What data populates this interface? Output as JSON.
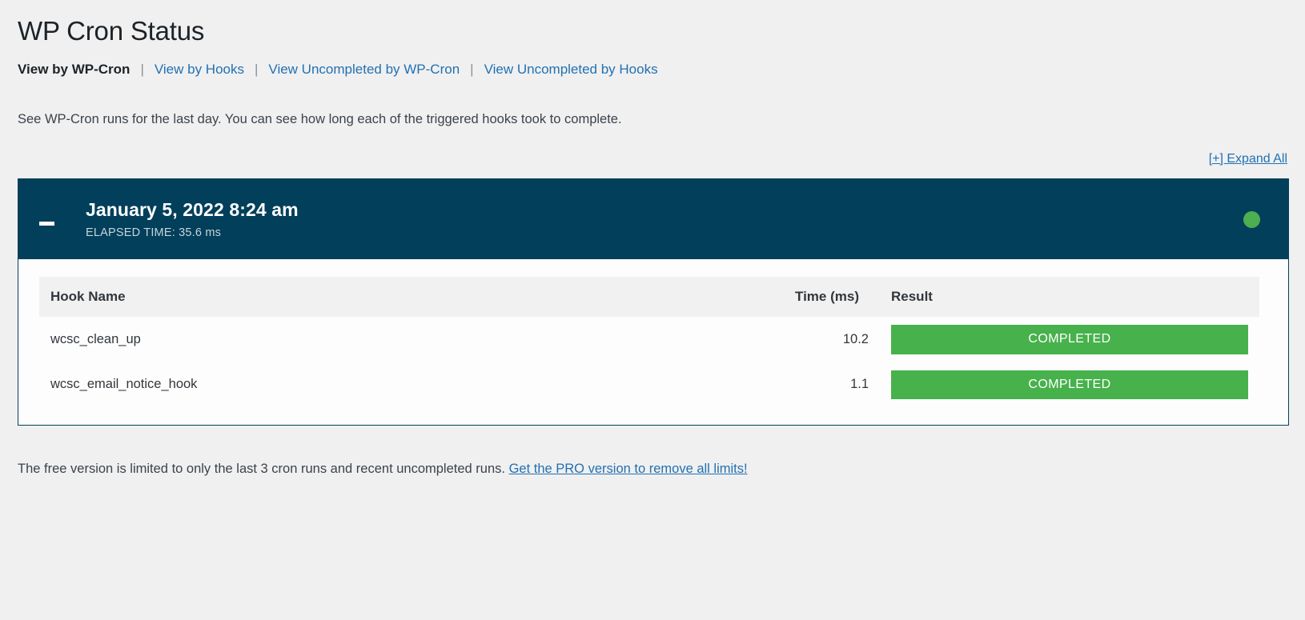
{
  "page": {
    "title": "WP Cron Status",
    "description": "See WP-Cron runs for the last day. You can see how long each of the triggered hooks took to complete.",
    "expand_all_label": "[+] Expand All",
    "separator": "|"
  },
  "subnav": {
    "items": [
      {
        "label": "View by WP-Cron",
        "active": true
      },
      {
        "label": "View by Hooks",
        "active": false
      },
      {
        "label": "View Uncompleted by WP-Cron",
        "active": false
      },
      {
        "label": "View Uncompleted by Hooks",
        "active": false
      }
    ]
  },
  "cron_run": {
    "date": "January 5, 2022 8:24 am",
    "elapsed_label": "ELAPSED TIME: 35.6 ms",
    "status_color": "#4caf50",
    "header_color": "#023f5b",
    "collapse_state": "expanded",
    "table": {
      "headers": {
        "hook": "Hook Name",
        "time": "Time (ms)",
        "result": "Result"
      },
      "rows": [
        {
          "hook": "wcsc_clean_up",
          "time": "10.2",
          "result": "COMPLETED",
          "result_color": "#47b14c"
        },
        {
          "hook": "wcsc_email_notice_hook",
          "time": "1.1",
          "result": "COMPLETED",
          "result_color": "#47b14c"
        }
      ]
    }
  },
  "footer": {
    "note_text": "The free version is limited to only the last 3 cron runs and recent uncompleted runs. ",
    "pro_link": "Get the PRO version to remove all limits!"
  }
}
